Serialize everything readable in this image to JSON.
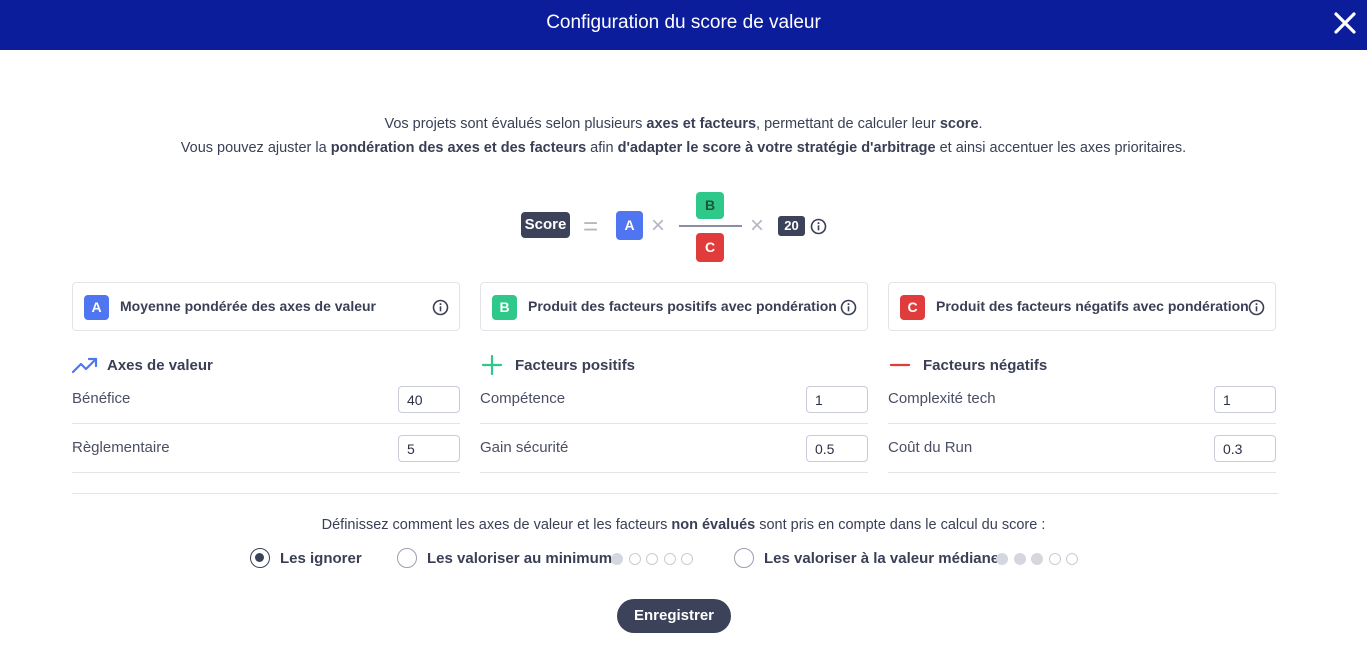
{
  "header": {
    "title": "Configuration du score de valeur",
    "close_icon": "close-icon"
  },
  "intro": {
    "line1": [
      {
        "t": "Vos projets sont évalués selon plusieurs ",
        "b": false
      },
      {
        "t": "axes et facteurs",
        "b": true
      },
      {
        "t": ", permettant de calculer leur ",
        "b": false
      },
      {
        "t": "score",
        "b": true
      },
      {
        "t": ".",
        "b": false
      }
    ],
    "line2": [
      {
        "t": "Vous pouvez ajuster la ",
        "b": false
      },
      {
        "t": "pondération des axes et des facteurs",
        "b": true
      },
      {
        "t": " afin ",
        "b": false
      },
      {
        "t": "d'adapter le score à votre stratégie d'arbitrage",
        "b": true
      },
      {
        "t": " et ainsi accentuer les axes prioritaires.",
        "b": false
      }
    ]
  },
  "formula": {
    "score": "Score",
    "equals": "=",
    "a": "A",
    "times": "×",
    "b": "B",
    "c": "C",
    "multiplier": "20",
    "info_icon": "info-icon"
  },
  "colors": {
    "header": "#0c1d9c",
    "a": "#4f76f0",
    "b": "#2ec98a",
    "c": "#e03c3c",
    "dark": "#3b4259"
  },
  "cards": [
    {
      "letter": "A",
      "text": "Moyenne pondérée des axes de valeur",
      "color": "#4f76f0"
    },
    {
      "letter": "B",
      "text": "Produit des facteurs positifs avec pondération",
      "color": "#2ec98a"
    },
    {
      "letter": "C",
      "text": "Produit des facteurs négatifs avec pondération",
      "color": "#e03c3c"
    }
  ],
  "columns": [
    {
      "title": "Axes de valeur",
      "icon": "trending-up-icon",
      "rows": [
        {
          "label": "Bénéfice",
          "value": "40"
        },
        {
          "label": "Règlementaire",
          "value": "5"
        }
      ]
    },
    {
      "title": "Facteurs positifs",
      "icon": "plus-icon",
      "rows": [
        {
          "label": "Compétence",
          "value": "1"
        },
        {
          "label": "Gain sécurité",
          "value": "0.5"
        }
      ]
    },
    {
      "title": "Facteurs négatifs",
      "icon": "minus-icon",
      "rows": [
        {
          "label": "Complexité tech",
          "value": "1"
        },
        {
          "label": "Coût du Run",
          "value": "0.3"
        }
      ]
    }
  ],
  "question": {
    "before": "Définissez comment les axes de valeur et les facteurs ",
    "bold": "non évalués",
    "after": " sont pris en compte dans le calcul du score :"
  },
  "options": [
    {
      "label": "Les ignorer",
      "checked": true,
      "level": null
    },
    {
      "label": "Les valoriser au minimum",
      "checked": false,
      "level": 1,
      "max": 5
    },
    {
      "label": "Les valoriser à la valeur médiane",
      "checked": false,
      "level": 3,
      "max": 5
    }
  ],
  "save_label": "Enregistrer"
}
